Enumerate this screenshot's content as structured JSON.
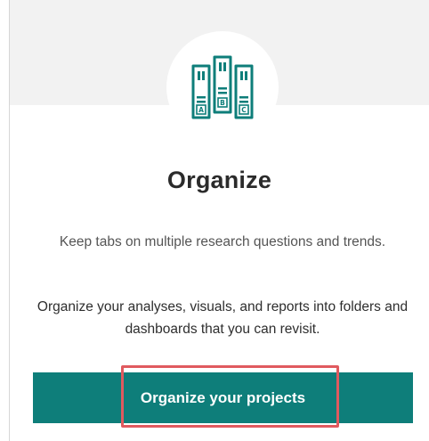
{
  "card": {
    "title": "Organize",
    "description_primary": "Keep tabs on multiple research questions and trends.",
    "description_secondary": "Organize your analyses, visuals, and reports into folders and dashboards that you can revisit.",
    "cta_label": "Organize your projects"
  },
  "icon": {
    "name": "binders-icon",
    "binder_labels": [
      "A",
      "B",
      "C"
    ]
  },
  "colors": {
    "accent": "#0e7e7a",
    "highlight": "#e05a5f",
    "hero_background": "#f2f2f2"
  }
}
